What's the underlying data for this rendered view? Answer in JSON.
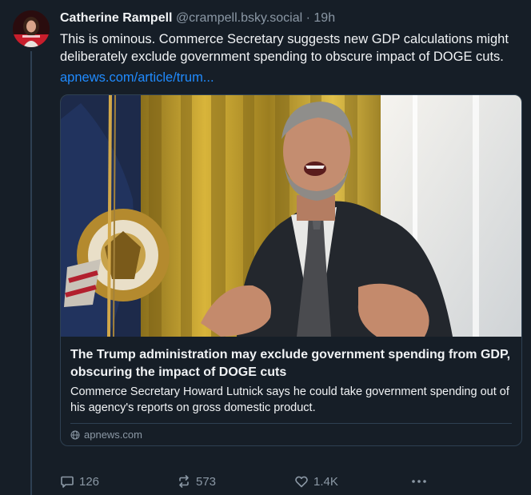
{
  "post": {
    "author_name": "Catherine Rampell",
    "author_handle": "@crampell.bsky.social",
    "separator": "·",
    "timestamp": "19h",
    "text": "This is ominous. Commerce Secretary suggests new GDP calculations might deliberately exclude government spending to obscure impact of DOGE cuts.",
    "link_text": "apnews.com/article/trum..."
  },
  "embed": {
    "title": "The Trump administration may exclude government spending from GDP, obscuring the impact of DOGE cuts",
    "description": "Commerce Secretary Howard Lutnick says he could take government spending out of his agency's reports on gross domestic product.",
    "domain": "apnews.com",
    "image_subject": "man in dark suit speaking in front of presidential flag and gold curtains"
  },
  "actions": {
    "reply_count": "126",
    "repost_count": "573",
    "like_count": "1.4K",
    "more_icon": "ellipsis-icon"
  },
  "colors": {
    "background": "#161e27",
    "text": "#f1f3f5",
    "muted": "#8b98a5",
    "link": "#208bfe",
    "border": "#2e4052"
  }
}
